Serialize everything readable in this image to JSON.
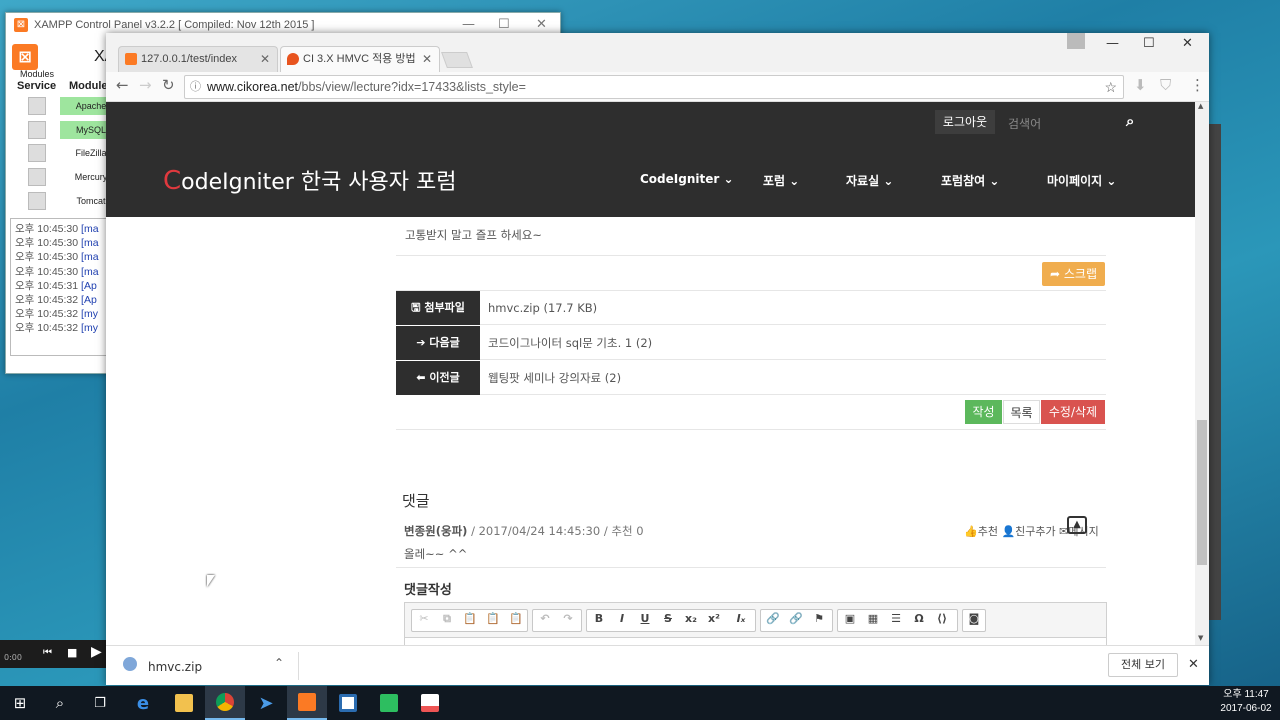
{
  "xampp": {
    "title": "XAMPP Control Panel v3.2.2   [ Compiled: Nov 12th 2015 ]",
    "header_title": "XA",
    "modules_label": "Modules",
    "service_label": "Service",
    "module_label": "Module",
    "modules": [
      {
        "name": "Apache"
      },
      {
        "name": "MySQL"
      },
      {
        "name": "FileZilla"
      },
      {
        "name": "Mercury"
      },
      {
        "name": "Tomcat"
      }
    ],
    "log": [
      {
        "time": "오후 10:45:30",
        "msg": "[ma"
      },
      {
        "time": "오후 10:45:30",
        "msg": "[ma"
      },
      {
        "time": "오후 10:45:30",
        "msg": "[ma"
      },
      {
        "time": "오후 10:45:30",
        "msg": "[ma"
      },
      {
        "time": "오후 10:45:31",
        "msg": "[Ap"
      },
      {
        "time": "오후 10:45:32",
        "msg": "[Ap"
      },
      {
        "time": "오후 10:45:32",
        "msg": "[my"
      },
      {
        "time": "오후 10:45:32",
        "msg": "[my"
      }
    ]
  },
  "media": {
    "time": "0:00"
  },
  "browser": {
    "tabs": [
      {
        "label": "127.0.0.1/test/index"
      },
      {
        "label": "CI 3.X HMVC 적용 방법"
      }
    ],
    "url_domain": "www.cikorea.net",
    "url_path": "/bbs/view/lecture?idx=17433&lists_style=",
    "site": {
      "logout": "로그아웃",
      "search_placeholder": "검색어",
      "title_first": "C",
      "title_rest": "odeIgniter 한국 사용자 포럼",
      "nav": [
        {
          "label": "CodeIgniter"
        },
        {
          "label": "포럼"
        },
        {
          "label": "자료실"
        },
        {
          "label": "포럼참여"
        },
        {
          "label": "마이페이지"
        }
      ]
    },
    "post": {
      "closing_text": "고통받지 말고 즐프 하세요~",
      "scrap": "스크랩",
      "rows": [
        {
          "label": "첨부파일",
          "value": "hmvc.zip (17.7 KB)"
        },
        {
          "label": "다음글",
          "value": "코드이그나이터 sql문 기초. 1 (2)"
        },
        {
          "label": "이전글",
          "value": "웹팅팟 세미나 강의자료 (2)"
        }
      ],
      "write": "작성",
      "list": "목록",
      "edit_delete": "수정/삭제"
    },
    "comments": {
      "heading": "댓글",
      "author": "변종원(웅파)",
      "meta": " / 2017/04/24 14:45:30 / 추천 0",
      "recommend": "추천",
      "add_friend": "친구추가",
      "message": "메시지",
      "text": "올레~~ ^^",
      "write_heading": "댓글작성"
    },
    "download": {
      "filename": "hmvc.zip",
      "show_all": "전체 보기"
    }
  },
  "taskbar": {
    "time": "오후 11:47",
    "date": "2017-06-02"
  }
}
